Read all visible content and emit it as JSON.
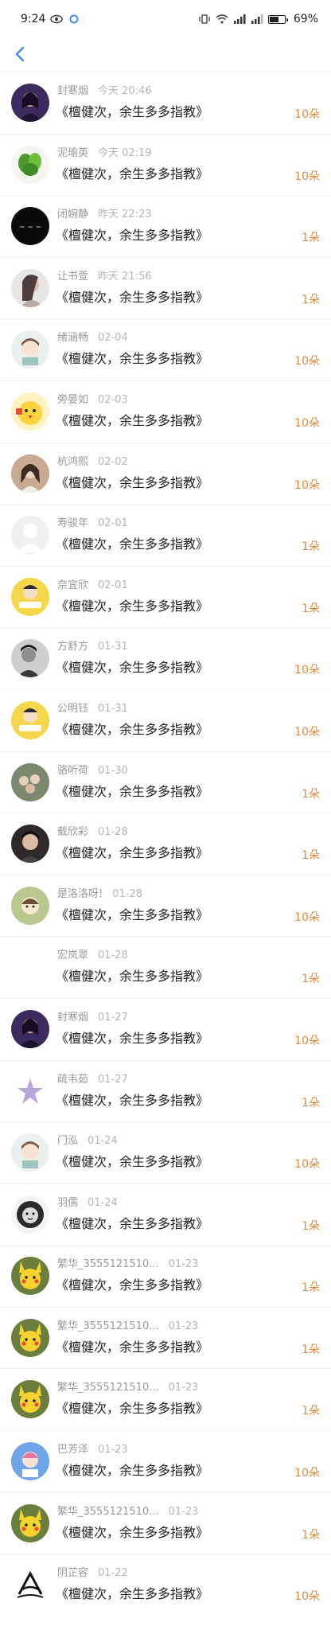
{
  "status_bar": {
    "time": "9:24",
    "battery": "69%",
    "battery_level": 0.69
  },
  "header": {
    "back_icon": "chevron-left-icon",
    "accent_color": "#3a8ee6"
  },
  "gift_color": "#e08a3c",
  "records": [
    {
      "name": "封寒烟",
      "time": "今天 20:46",
      "gift": "《檀健次，余生多多指教》",
      "count": "10朵",
      "avatar": "portrait-dark"
    },
    {
      "name": "泥瑜英",
      "time": "今天 02:19",
      "gift": "《檀健次，余生多多指教》",
      "count": "10朵",
      "avatar": "plant"
    },
    {
      "name": "闭婉静",
      "time": "昨天 22:23",
      "gift": "《檀健次，余生多多指教》",
      "count": "1朵",
      "avatar": "black-text"
    },
    {
      "name": "让书萱",
      "time": "昨天 21:56",
      "gift": "《檀健次，余生多多指教》",
      "count": "1朵",
      "avatar": "portrait-gray"
    },
    {
      "name": "绪涵畅",
      "time": "02-04",
      "gift": "《檀健次，余生多多指教》",
      "count": "10朵",
      "avatar": "cartoon-light"
    },
    {
      "name": "旁晏如",
      "time": "02-03",
      "gift": "《檀健次，余生多多指教》",
      "count": "10朵",
      "avatar": "yellow-chick"
    },
    {
      "name": "杭鸿熙",
      "time": "02-02",
      "gift": "《檀健次，余生多多指教》",
      "count": "10朵",
      "avatar": "portrait-warm"
    },
    {
      "name": "寿骏年",
      "time": "02-01",
      "gift": "《檀健次，余生多多指教》",
      "count": "1朵",
      "avatar": "default"
    },
    {
      "name": "奈宜欣",
      "time": "02-01",
      "gift": "《檀健次，余生多多指教》",
      "count": "1朵",
      "avatar": "sticker-yellow"
    },
    {
      "name": "方舒方",
      "time": "01-31",
      "gift": "《檀健次，余生多多指教》",
      "count": "10朵",
      "avatar": "portrait-bw"
    },
    {
      "name": "公明钰",
      "time": "01-31",
      "gift": "《檀健次，余生多多指教》",
      "count": "10朵",
      "avatar": "sticker-yellow"
    },
    {
      "name": "骆听荷",
      "time": "01-30",
      "gift": "《檀健次，余生多多指教》",
      "count": "1朵",
      "avatar": "group"
    },
    {
      "name": "载欣彩",
      "time": "01-28",
      "gift": "《檀健次，余生多多指教》",
      "count": "1朵",
      "avatar": "portrait-dark2"
    },
    {
      "name": "是洛洛呀!",
      "time": "01-28",
      "gift": "《檀健次，余生多多指教》",
      "count": "10朵",
      "avatar": "cartoon-green"
    },
    {
      "name": "宏岚翠",
      "time": "01-28",
      "gift": "《檀健次，余生多多指教》",
      "count": "1朵",
      "avatar": "none"
    },
    {
      "name": "封寒烟",
      "time": "01-27",
      "gift": "《檀健次，余生多多指教》",
      "count": "10朵",
      "avatar": "portrait-dark"
    },
    {
      "name": "疏韦茹",
      "time": "01-27",
      "gift": "《檀健次，余生多多指教》",
      "count": "1朵",
      "avatar": "purple-star"
    },
    {
      "name": "门泓",
      "time": "01-24",
      "gift": "《檀健次，余生多多指教》",
      "count": "10朵",
      "avatar": "cartoon-light"
    },
    {
      "name": "羽儒",
      "time": "01-24",
      "gift": "《檀健次，余生多多指教》",
      "count": "1朵",
      "avatar": "lion"
    },
    {
      "name": "繁华_3555121510...",
      "time": "01-23",
      "gift": "《檀健次，余生多多指教》",
      "count": "1朵",
      "avatar": "pikachu"
    },
    {
      "name": "繁华_3555121510...",
      "time": "01-23",
      "gift": "《檀健次，余生多多指教》",
      "count": "1朵",
      "avatar": "pikachu"
    },
    {
      "name": "繁华_3555121510...",
      "time": "01-23",
      "gift": "《檀健次，余生多多指教》",
      "count": "1朵",
      "avatar": "pikachu"
    },
    {
      "name": "巴芳泽",
      "time": "01-23",
      "gift": "《檀健次，余生多多指教》",
      "count": "10朵",
      "avatar": "blue-cartoon"
    },
    {
      "name": "繁华_3555121510...",
      "time": "01-23",
      "gift": "《檀健次，余生多多指教》",
      "count": "1朵",
      "avatar": "pikachu"
    },
    {
      "name": "阴芷容",
      "time": "01-22",
      "gift": "《檀健次，余生多多指教》",
      "count": "10朵",
      "avatar": "logo-ink"
    }
  ]
}
